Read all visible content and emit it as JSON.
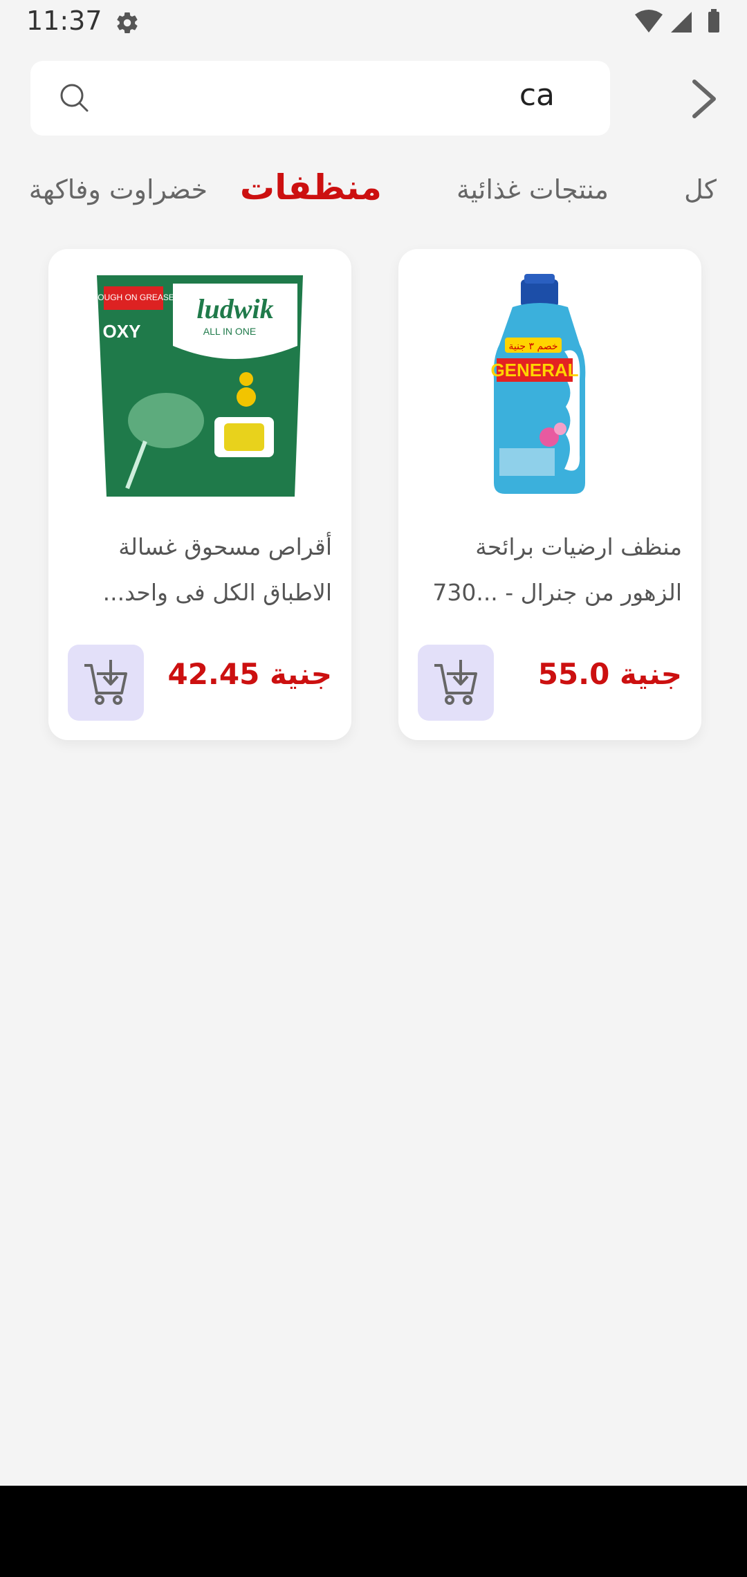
{
  "status_bar": {
    "time": "11:37"
  },
  "search": {
    "value": "ca"
  },
  "tabs": [
    {
      "label": "كل",
      "active": false
    },
    {
      "label": "منتجات غذائية",
      "active": false
    },
    {
      "label": "منظفات",
      "active": true
    },
    {
      "label": "خضراوت وفاكهة",
      "active": false
    }
  ],
  "products": [
    {
      "title_line1": "منظف ارضيات برائحة",
      "title_line2": "الزهور من جنرال - ...730",
      "price": "جنية 55.0"
    },
    {
      "title_line1": "أقراص مسحوق غسالة",
      "title_line2": "الاطباق الكل فى واحد...",
      "price": "جنية 42.45"
    }
  ],
  "images": {
    "general_label": "GENERAL",
    "general_badge": "خصم ٣ جنية",
    "ludwik_brand": "ludwik",
    "ludwik_sub": "ALL IN ONE",
    "ludwik_tag": "TOUGH ON GREASE",
    "ludwik_oxy": "OXY"
  },
  "colors": {
    "accent": "#cc1010",
    "cart_bg": "#e3e0f9"
  }
}
